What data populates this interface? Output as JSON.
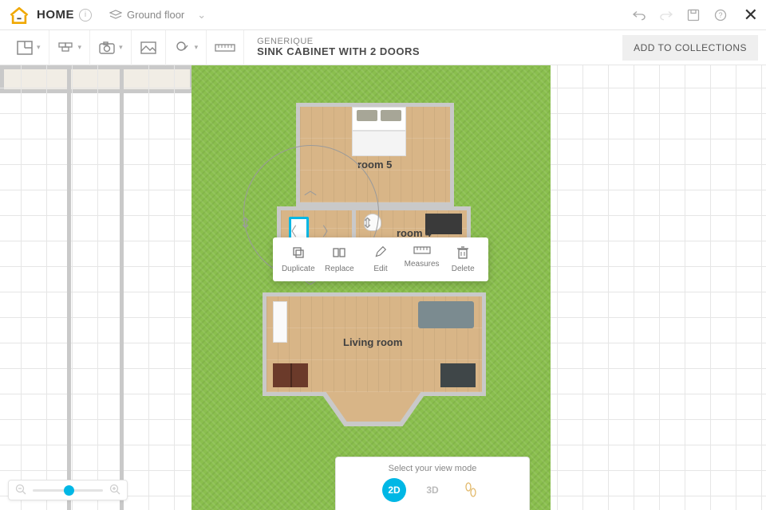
{
  "header": {
    "title": "HOME",
    "floor_label": "Ground floor"
  },
  "product": {
    "brand": "GENERIQUE",
    "name": "SINK CABINET WITH 2 DOORS"
  },
  "add_collections": "ADD TO COLLECTIONS",
  "rooms": {
    "room5": "room 5",
    "room4": "room 4",
    "living": "Living room"
  },
  "popup": {
    "duplicate": "Duplicate",
    "replace": "Replace",
    "edit": "Edit",
    "measures": "Measures",
    "delete": "Delete"
  },
  "viewmode": {
    "label": "Select your view mode",
    "v2d": "2D",
    "v3d": "3D"
  }
}
